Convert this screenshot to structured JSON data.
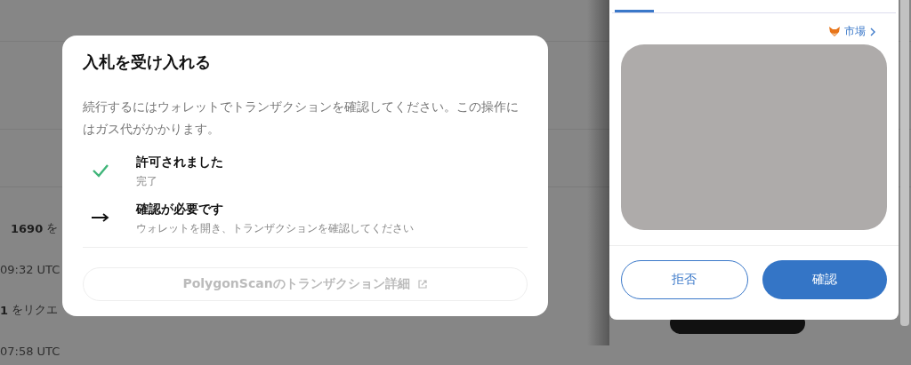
{
  "background_list": [
    {
      "kind": "amount",
      "amount": "1690",
      "text": "を"
    },
    {
      "kind": "time",
      "text": "09:32 UTC"
    },
    {
      "kind": "amount",
      "amount": "1",
      "text": "をリクエ"
    },
    {
      "kind": "time",
      "text": "07:58 UTC"
    }
  ],
  "dialog": {
    "title": "入札を受け入れる",
    "description": "続行するにはウォレットでトランザクションを確認してください。この操作にはガス代がかかります。",
    "steps": [
      {
        "kind": "done",
        "title": "許可されました",
        "subtitle": "完了"
      },
      {
        "kind": "pending",
        "title": "確認が必要です",
        "subtitle": "ウォレットを開き、トランザクションを確認してください"
      }
    ],
    "link_button": {
      "label": "PolygonScanのトランザクション詳細",
      "disabled": true
    }
  },
  "wallet": {
    "market_link": "市場",
    "buttons": [
      {
        "kind": "secondary",
        "label": "拒否"
      },
      {
        "kind": "primary",
        "label": "確認"
      }
    ]
  }
}
